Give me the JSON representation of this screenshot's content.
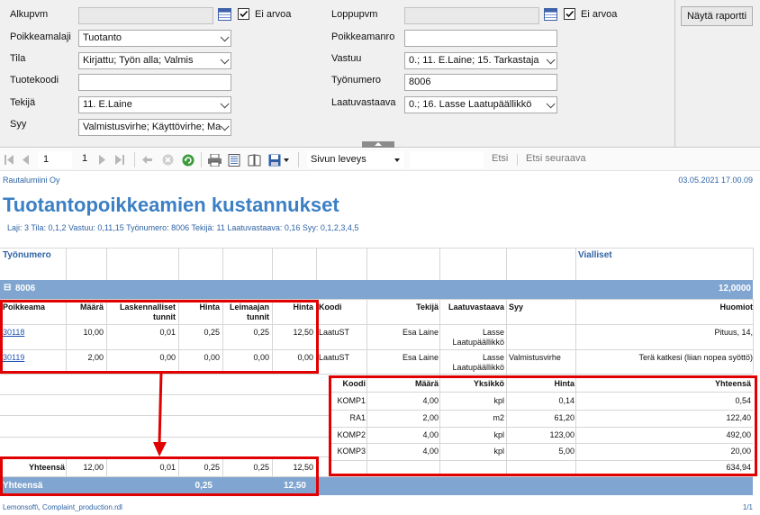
{
  "filters": {
    "alkupvm_label": "Alkupvm",
    "loppupvm_label": "Loppupvm",
    "ei_arvoa_label": "Ei arvoa",
    "poikkeamalaji_label": "Poikkeamalaji",
    "poikkeamalaji_value": "Tuotanto",
    "poikkeamanro_label": "Poikkeamanro",
    "poikkeamanro_value": "",
    "tila_label": "Tila",
    "tila_value": "Kirjattu; Työn alla; Valmis",
    "vastuu_label": "Vastuu",
    "vastuu_value": "0.; 11. E.Laine; 15. Tarkastaja",
    "tuotekoodi_label": "Tuotekoodi",
    "tuotekoodi_value": "",
    "tyonumero_label": "Työnumero",
    "tyonumero_value": "8006",
    "tekija_label": "Tekijä",
    "tekija_value": "11. E.Laine",
    "laatuvastaava_label": "Laatuvastaava",
    "laatuvastaava_value": "0.; 16. Lasse Laatupäällikkö",
    "syy_label": "Syy",
    "syy_value": "Valmistusvirhe; Käyttövirhe; Ma",
    "show_report_label": "Näytä raportti"
  },
  "toolbar": {
    "page_current": "1",
    "page_total": "1",
    "zoom_value": "Sivun leveys",
    "find_label": "Etsi",
    "find_next_label": "Etsi seuraava"
  },
  "report": {
    "company": "Rautalumiini Oy",
    "date": "03.05.2021 17.00.09",
    "title": "Tuotantopoikkeamien kustannukset",
    "params": "Laji: 3  Tila: 0,1,2 Vastuu: 0,11,15  Työnumero: 8006 Tekijä: 11 Laatuvastaava: 0,16 Syy: 0,1,2,3,4,5",
    "col_tyonumero": "Työnumero",
    "col_vialliset": "Vialliset",
    "group_expand": "⊟",
    "group_label": "8006",
    "group_value": "12,0000",
    "headers": {
      "poikkeama": "Poikkeama",
      "maara": "Määrä",
      "laskennalliset": "Laskennalliset",
      "tunnit": "tunnit",
      "hinta": "Hinta",
      "leimaajan": "Leimaajan",
      "leimaajan_tunnit": "tunnit",
      "hinta2": "Hinta",
      "koodi": "Koodi",
      "tekija": "Tekijä",
      "laatuvastaava": "Laatuvastaava",
      "syy": "Syy",
      "huomiot": "Huomiot"
    },
    "rows": [
      {
        "poikkeama": "30118",
        "maara": "10,00",
        "lask": "0,01",
        "hinta": "0,25",
        "leim": "0,25",
        "hinta2": "12,50",
        "koodi": "LaatuST",
        "tekija": "Esa Laine",
        "lv1": "Lasse",
        "lv2": "Laatupäällikkö",
        "syy": "",
        "huomiot": "Pituus, 14,"
      },
      {
        "poikkeama": "30119",
        "maara": "2,00",
        "lask": "0,00",
        "hinta": "0,00",
        "leim": "0,00",
        "hinta2": "0,00",
        "koodi": "LaatuST",
        "tekija": "Esa Laine",
        "lv1": "Lasse",
        "lv2": "Laatupäällikkö",
        "syy": "Valmistusvirhe",
        "huomiot": "Terä katkesi (liian nopea syöttö)"
      }
    ],
    "materials": {
      "headers": {
        "koodi": "Koodi",
        "maara": "Määrä",
        "yksikko": "Yksikkö",
        "hinta": "Hinta",
        "yhteensa": "Yhteensä"
      },
      "rows": [
        {
          "koodi": "KOMP1",
          "maara": "4,00",
          "yksikko": "kpl",
          "hinta": "0,14",
          "yhteensa": "0,54"
        },
        {
          "koodi": "RA1",
          "maara": "2,00",
          "yksikko": "m2",
          "hinta": "61,20",
          "yhteensa": "122,40"
        },
        {
          "koodi": "KOMP2",
          "maara": "4,00",
          "yksikko": "kpl",
          "hinta": "123,00",
          "yhteensa": "492,00"
        },
        {
          "koodi": "KOMP3",
          "maara": "4,00",
          "yksikko": "kpl",
          "hinta": "5,00",
          "yhteensa": "20,00"
        }
      ],
      "total": "634,94"
    },
    "subtotal": {
      "label": "Yhteensä",
      "maara": "12,00",
      "lask": "0,01",
      "hinta": "0,25",
      "leim": "0,25",
      "hinta2": "12,50"
    },
    "grandtotal": {
      "label": "Yhteensä",
      "hinta": "0,25",
      "hinta2": "12,50"
    },
    "footer_left": "Lemonsoft\\, Complaint_production.rdl",
    "footer_right": "1/1"
  },
  "colors": {
    "accent": "#3b7fc4",
    "bar": "#7fa5d0",
    "highlight": "#e00000"
  }
}
